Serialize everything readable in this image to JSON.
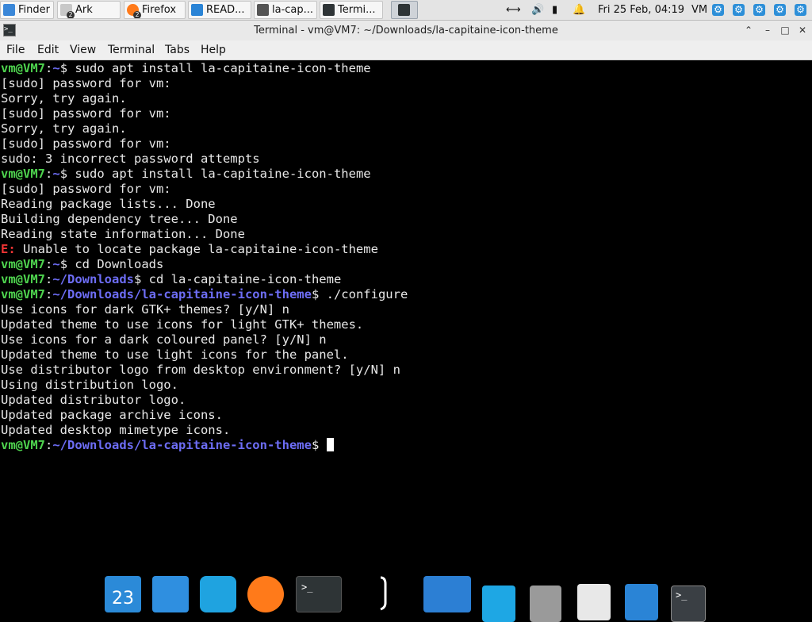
{
  "taskbar": {
    "tasks": [
      {
        "label": "Finder",
        "badge": ""
      },
      {
        "label": "Ark",
        "badge": "2"
      },
      {
        "label": "Firefox",
        "badge": "2"
      },
      {
        "label": "READ...",
        "badge": ""
      },
      {
        "label": "la-cap...",
        "badge": ""
      },
      {
        "label": "Termi...",
        "badge": ""
      }
    ],
    "clock": "Fri 25 Feb, 04:19",
    "user": "VM"
  },
  "window": {
    "title": "Terminal - vm@VM7: ~/Downloads/la-capitaine-icon-theme"
  },
  "menubar": {
    "items": [
      "File",
      "Edit",
      "View",
      "Terminal",
      "Tabs",
      "Help"
    ]
  },
  "terminal": {
    "lines": [
      {
        "user": "vm@VM7",
        "sep": ":",
        "path": "~",
        "text": "$ sudo apt install la-capitaine-icon-theme"
      },
      {
        "text": "[sudo] password for vm:"
      },
      {
        "text": "Sorry, try again."
      },
      {
        "text": "[sudo] password for vm:"
      },
      {
        "text": "Sorry, try again."
      },
      {
        "text": "[sudo] password for vm:"
      },
      {
        "text": "sudo: 3 incorrect password attempts"
      },
      {
        "user": "vm@VM7",
        "sep": ":",
        "path": "~",
        "text": "$ sudo apt install la-capitaine-icon-theme"
      },
      {
        "text": "[sudo] password for vm:"
      },
      {
        "text": "Reading package lists... Done"
      },
      {
        "text": "Building dependency tree... Done"
      },
      {
        "text": "Reading state information... Done"
      },
      {
        "err": "E:",
        "text": " Unable to locate package la-capitaine-icon-theme"
      },
      {
        "user": "vm@VM7",
        "sep": ":",
        "path": "~",
        "text": "$ cd Downloads"
      },
      {
        "user": "vm@VM7",
        "sep": ":",
        "path": "~/Downloads",
        "text": "$ cd la-capitaine-icon-theme"
      },
      {
        "user": "vm@VM7",
        "sep": ":",
        "path": "~/Downloads/la-capitaine-icon-theme",
        "text": "$ ./configure"
      },
      {
        "text": "Use icons for dark GTK+ themes? [y/N] n"
      },
      {
        "text": "Updated theme to use icons for light GTK+ themes."
      },
      {
        "text": "Use icons for a dark coloured panel? [y/N] n"
      },
      {
        "text": "Updated theme to use light icons for the panel."
      },
      {
        "text": "Use distributor logo from desktop environment? [y/N] n"
      },
      {
        "text": "Using distribution logo."
      },
      {
        "text": "Updated distributor logo."
      },
      {
        "text": "Updated package archive icons."
      },
      {
        "text": "Updated desktop mimetype icons."
      },
      {
        "user": "vm@VM7",
        "sep": ":",
        "path": "~/Downloads/la-capitaine-icon-theme",
        "text": "$ ",
        "cursor": true
      }
    ]
  },
  "dock": {
    "calendar_day": "23",
    "terminal_glyph": ">_",
    "items": [
      {
        "name": "calendar-icon",
        "color": "#2b8ad8"
      },
      {
        "name": "mail-stamp-icon",
        "color": "#2f8fe0"
      },
      {
        "name": "wave-app-icon",
        "color": "#1fa3e0"
      },
      {
        "name": "firefox-icon",
        "color": "#ff7a1a"
      },
      {
        "name": "terminal-icon",
        "color": "#2e3436"
      },
      {
        "name": "anchor-icon",
        "color": "#ffffff"
      },
      {
        "name": "video-player-icon",
        "color": "#2c7fd4"
      },
      {
        "name": "folder-icon",
        "color": "#1ea7e4"
      },
      {
        "name": "network-icon",
        "color": "#9a9a9a"
      },
      {
        "name": "archive-icon",
        "color": "#e8e8e8"
      },
      {
        "name": "document-icon",
        "color": "#2a84d6"
      },
      {
        "name": "terminal-app-icon",
        "color": "#3a3f44"
      }
    ]
  }
}
